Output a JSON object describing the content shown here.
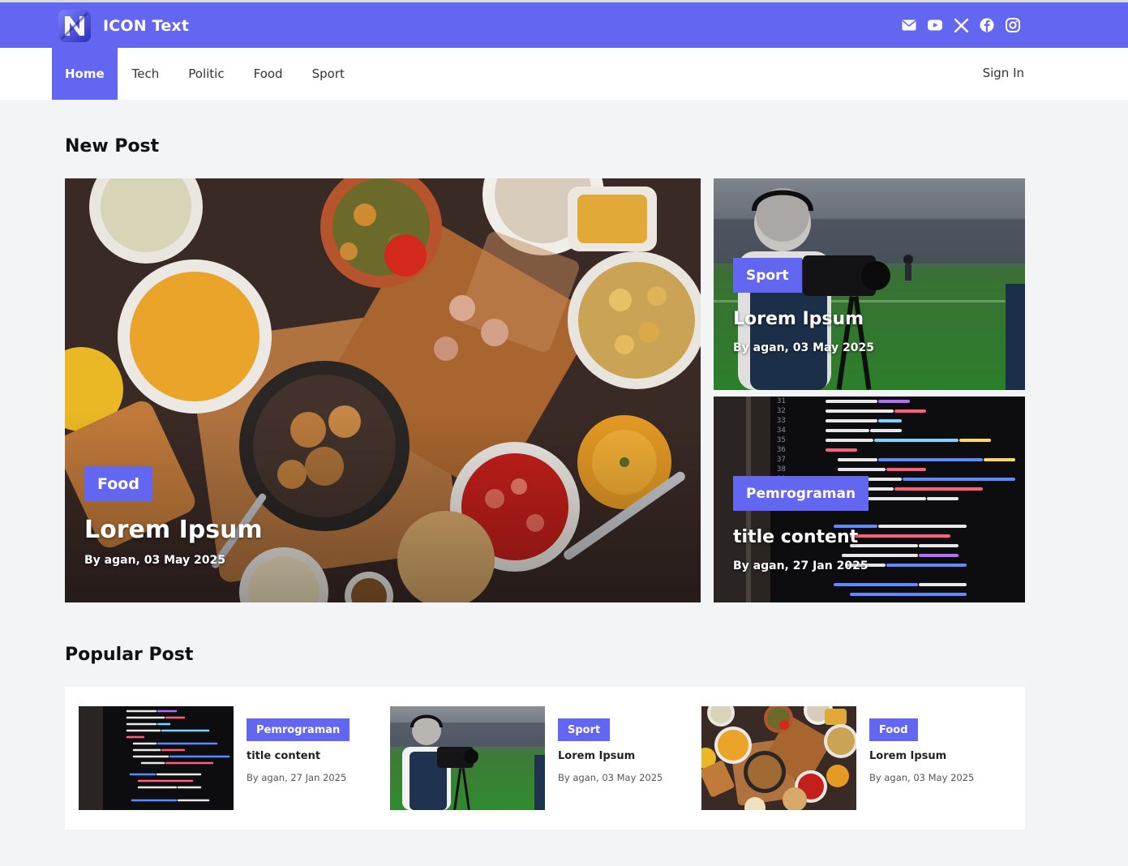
{
  "brand": {
    "name": "ICON Text",
    "logo_icon": "n-logo-icon"
  },
  "header": {
    "socials": [
      {
        "name": "mail-icon"
      },
      {
        "name": "youtube-icon"
      },
      {
        "name": "x-icon"
      },
      {
        "name": "facebook-icon"
      },
      {
        "name": "instagram-icon"
      }
    ]
  },
  "nav": {
    "items": [
      "Home",
      "Tech",
      "Politic",
      "Food",
      "Sport"
    ],
    "active": "Home",
    "signin": "Sign In"
  },
  "new_post": {
    "title": "New Post",
    "featured": {
      "tag": "Food",
      "title": "Lorem Ipsum",
      "meta": "By agan, 03 May 2025"
    },
    "side": [
      {
        "tag": "Sport",
        "title": "Lorem Ipsum",
        "meta": "By agan, 03 May 2025"
      },
      {
        "tag": "Pemrograman",
        "title": "title content",
        "meta": "By agan, 27 Jan 2025"
      }
    ]
  },
  "popular_post": {
    "title": "Popular Post",
    "items": [
      {
        "tag": "Pemrograman",
        "title": "title content",
        "meta": "By agan, 27 Jan 2025"
      },
      {
        "tag": "Sport",
        "title": "Lorem Ipsum",
        "meta": "By agan, 03 May 2025"
      },
      {
        "tag": "Food",
        "title": "Lorem Ipsum",
        "meta": "By agan, 03 May 2025"
      }
    ]
  },
  "colors": {
    "accent": "#6366f1",
    "background": "#f3f4f6"
  }
}
